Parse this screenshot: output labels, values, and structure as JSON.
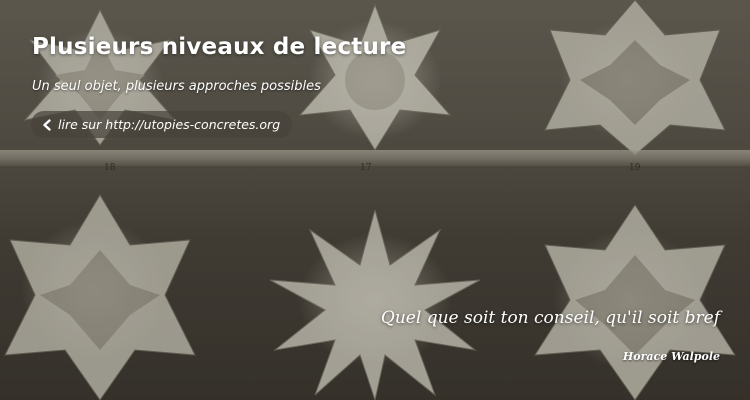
{
  "header": {
    "title": "Plusieurs niveaux de lecture",
    "subtitle": "Un seul objet, plusieurs approches possibles"
  },
  "back_link": {
    "icon": "chevron-left-icon",
    "label": "lire sur http://utopies-concretes.org"
  },
  "quote": {
    "text": "Quel que soit ton conseil, qu'il soit bref",
    "author": "Horace Walpole"
  },
  "background": {
    "plate_numbers": [
      "18",
      "17",
      "19"
    ]
  },
  "colors": {
    "text": "#ffffff",
    "pill_background": "#46423a"
  }
}
